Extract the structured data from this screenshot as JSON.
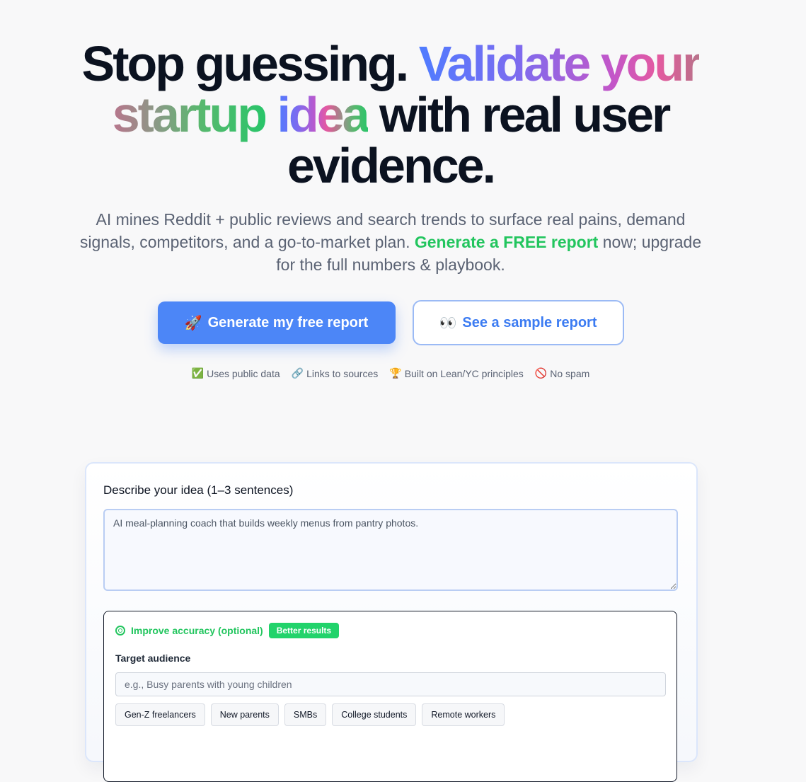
{
  "hero": {
    "headline_part1": "Stop guessing.",
    "headline_gradient1": "Validate your startup",
    "headline_gradient2": "idea",
    "headline_part2": "with real user evidence.",
    "subtitle_part1": "AI mines Reddit + public reviews and search trends to surface real pains, demand signals, competitors, and a go-to-market plan.",
    "subtitle_highlight": "Generate a FREE report",
    "subtitle_part2": "now; upgrade for the full numbers & playbook."
  },
  "cta": {
    "primary_emoji": "🚀",
    "primary_label": "Generate my free report",
    "secondary_emoji": "👀",
    "secondary_label": "See a sample report"
  },
  "trust": [
    {
      "icon": "✅",
      "icon_name": "check-icon",
      "label": "Uses public data"
    },
    {
      "icon": "🔗",
      "icon_name": "link-icon",
      "label": "Links to sources"
    },
    {
      "icon": "🏆",
      "icon_name": "trophy-icon",
      "label": "Built on Lean/YC principles"
    },
    {
      "icon": "🚫",
      "icon_name": "no-entry-icon",
      "label": "No spam"
    }
  ],
  "form": {
    "idea_label": "Describe your idea (1–3 sentences)",
    "idea_value": "AI meal-planning coach that builds weekly menus from pantry photos.",
    "accuracy_title": "Improve accuracy (optional)",
    "accuracy_badge": "Better results",
    "audience_label": "Target audience",
    "audience_placeholder": "e.g., Busy parents with young children",
    "audience_chips": [
      "Gen-Z freelancers",
      "New parents",
      "SMBs",
      "College students",
      "Remote workers"
    ]
  },
  "colors": {
    "primary_blue": "#4c86f7",
    "accent_green": "#22c55e",
    "headline": "#0b1220",
    "muted_text": "#5a6273"
  }
}
